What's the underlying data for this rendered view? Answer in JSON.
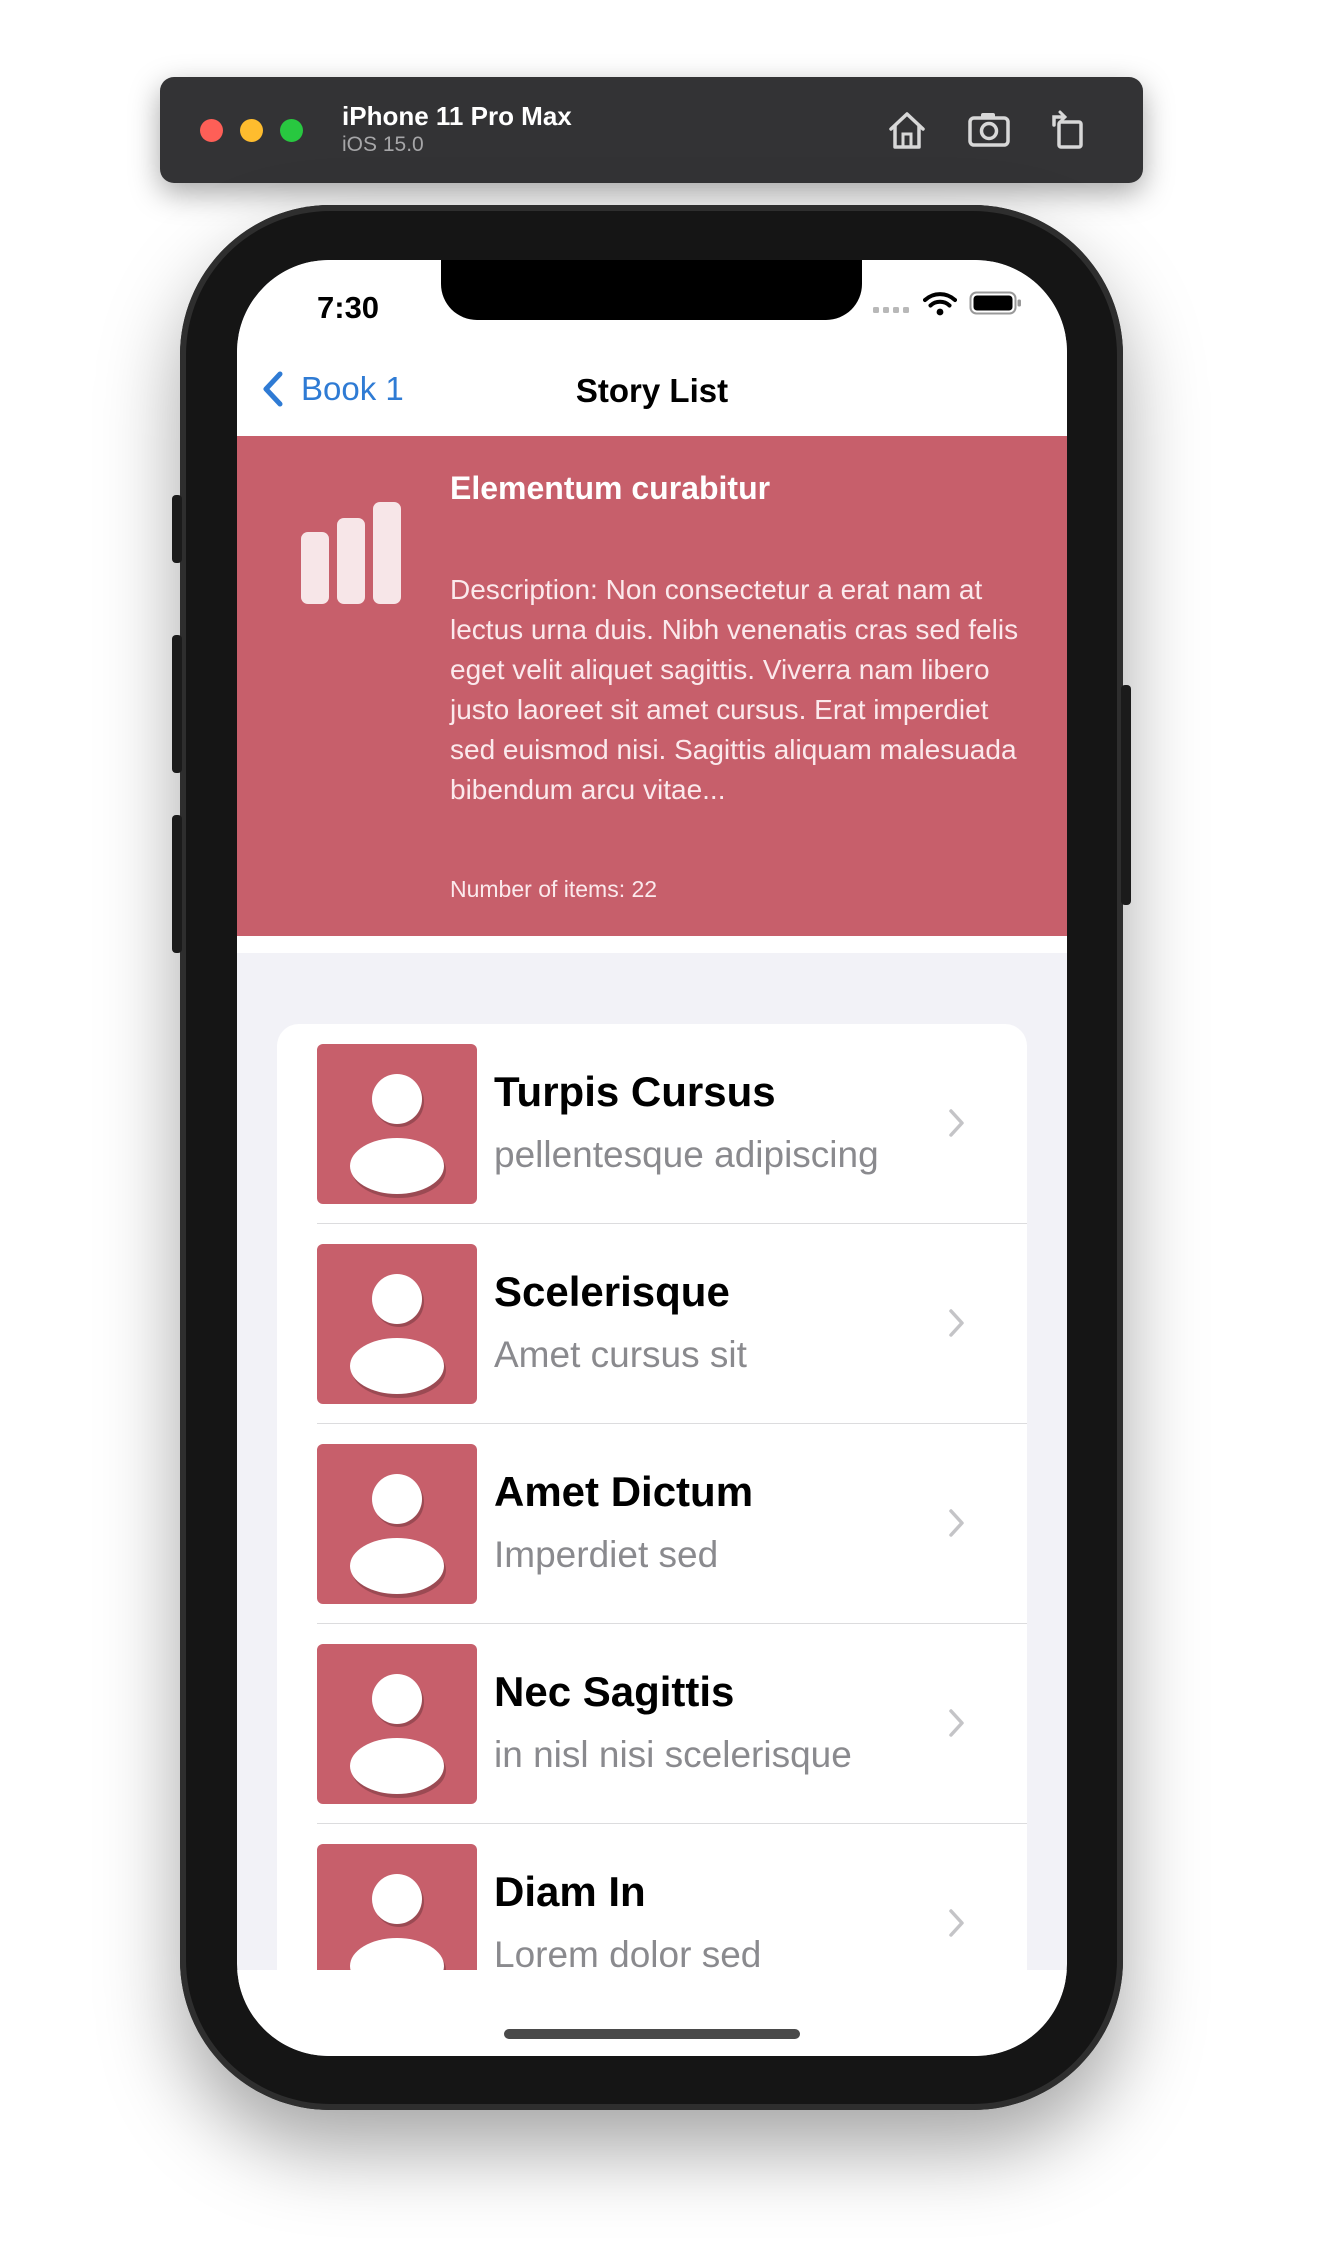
{
  "simulator": {
    "device_name": "iPhone 11 Pro Max",
    "os_version": "iOS 15.0",
    "toolbar_icons": [
      "home-icon",
      "screenshot-icon",
      "rotate-icon"
    ]
  },
  "status_bar": {
    "time": "7:30",
    "icons": [
      "signal-icon",
      "wifi-icon",
      "battery-icon"
    ]
  },
  "nav": {
    "back_label": "Book 1",
    "title": "Story List"
  },
  "header": {
    "title": "Elementum curabitur",
    "description": "Description: Non consectetur a erat nam at lectus urna duis. Nibh venenatis cras sed felis eget velit aliquet sagittis. Viverra nam libero justo laoreet sit amet cursus. Erat imperdiet sed euismod nisi. Sagittis aliquam malesuada bibendum arcu vitae...",
    "count_text": "Number of items: 22",
    "icon": "bar-chart-icon"
  },
  "stories": [
    {
      "title": "Turpis Cursus",
      "subtitle": "pellentesque adipiscing"
    },
    {
      "title": "Scelerisque",
      "subtitle": "Amet cursus sit"
    },
    {
      "title": "Amet Dictum",
      "subtitle": "Imperdiet sed"
    },
    {
      "title": "Nec Sagittis",
      "subtitle": "in nisl nisi scelerisque"
    },
    {
      "title": "Diam In",
      "subtitle": "Lorem dolor sed"
    }
  ],
  "colors": {
    "accent": "#c75f6b",
    "link": "#2f7bd4"
  }
}
